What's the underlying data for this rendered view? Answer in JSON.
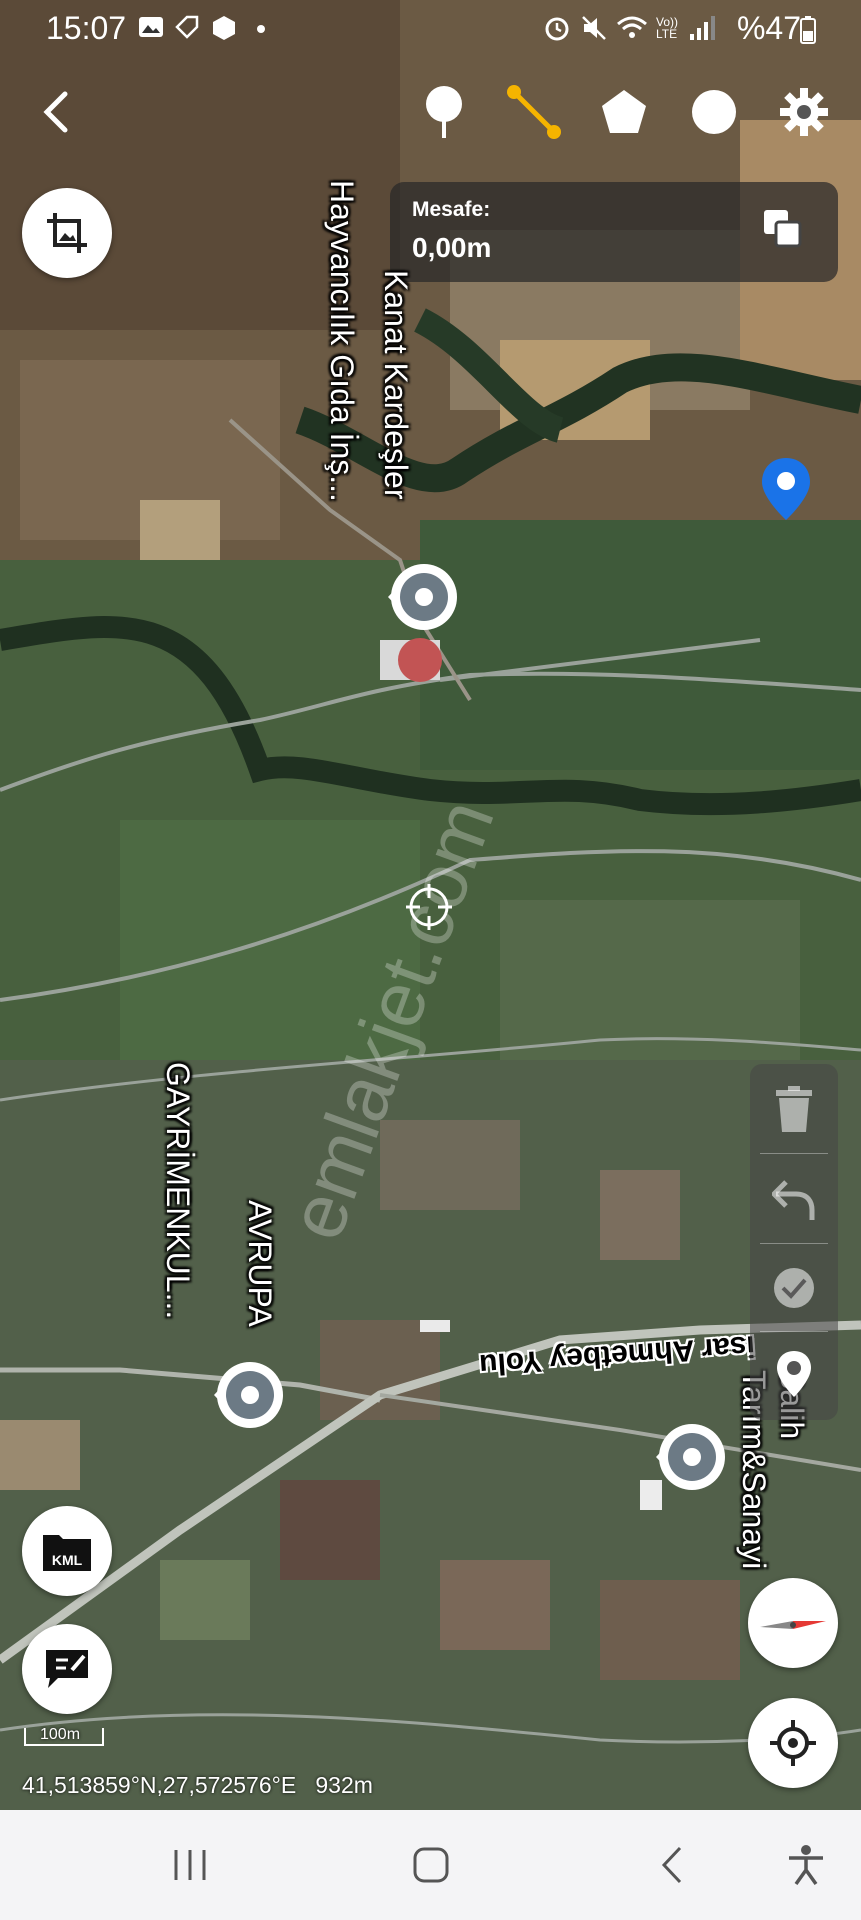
{
  "status_bar": {
    "time": "15:07",
    "battery": "%47",
    "lte": "Vo)) LTE"
  },
  "toolbar": {
    "tools": [
      "pin-tool",
      "line-tool",
      "polygon-tool",
      "circle-tool",
      "settings"
    ],
    "active_tool": "line-tool",
    "accent_color": "#f5b400"
  },
  "measure": {
    "label": "Mesafe:",
    "value": "0,00m"
  },
  "map": {
    "place_labels": [
      {
        "line1": "Kanat Kardeşler",
        "line2": "Hayvancılık Gıda İnş..."
      },
      {
        "line1": "AVRUPA",
        "line2": "GAYRİMENKUL..."
      },
      {
        "line1": "Salih",
        "line2": "Tarım&Sanayi"
      }
    ],
    "road_label": "Ahmetbey Yolu",
    "road_label_prefix": "isar",
    "watermark": "emlakjet.com",
    "coordinates": "41,513859°N,27,572576°E",
    "altitude": "932m",
    "scale_label": "100m",
    "location_color": "#1a73e8"
  },
  "side_buttons": {
    "kml_label": "KML"
  }
}
